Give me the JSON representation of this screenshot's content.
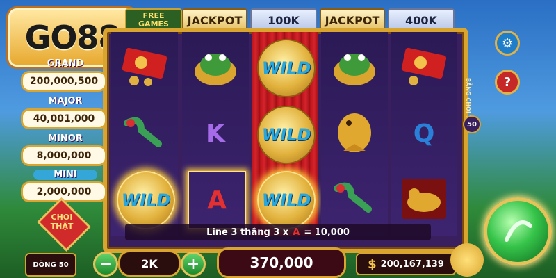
{
  "logo": {
    "text": "GO88"
  },
  "topbar": {
    "free_games": "FREE GAMES",
    "jackpot_label_1": "JACKPOT",
    "jackpot_value_1": "100K",
    "jackpot_label_2": "JACKPOT",
    "jackpot_value_2": "400K"
  },
  "jackpots": {
    "grand_label": "GRAND",
    "grand_value": "200,000,500",
    "major_label": "MAJOR",
    "major_value": "40,001,000",
    "minor_label": "MINOR",
    "minor_value": "8,000,000",
    "mini_label": "MINI",
    "mini_value": "2,000,000"
  },
  "choi_that": "CHƠI THẬT",
  "side": {
    "bang_choi_thu": "BẢNG CHƠI THỬ",
    "count": "50"
  },
  "reels": {
    "r1": [
      "red-envelope",
      "jade-ruyi",
      "WILD"
    ],
    "r2": [
      "gold-toad",
      "K",
      "A"
    ],
    "r3": [
      "WILD",
      "WILD",
      "WILD"
    ],
    "r4": [
      "gold-toad",
      "gold-carp",
      "jade-ruyi"
    ],
    "r5": [
      "red-envelope",
      "Q",
      "gold-ox"
    ]
  },
  "line_info": {
    "text_a": "Line 3 thắng 3 x",
    "text_b": "= 10,000"
  },
  "bottom": {
    "dong_label": "DÒNG",
    "dong_value": "50",
    "bet": "2K",
    "total": "370,000",
    "currency_symbol": "$",
    "balance": "200,167,139"
  },
  "colors": {
    "gold": "#d9a52e",
    "reel_bg": "#2b1a55",
    "wild_text": "#2aa6d8"
  }
}
